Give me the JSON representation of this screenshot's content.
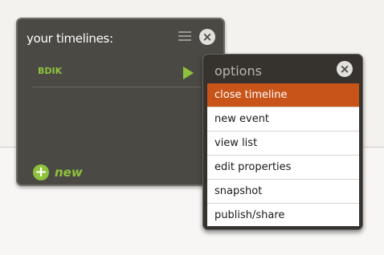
{
  "timelines_panel": {
    "title": "your timelines:",
    "items": [
      {
        "label": "BDIK"
      }
    ],
    "new_label": "new",
    "close_symbol": "×",
    "plus_symbol": "+"
  },
  "options_popup": {
    "title": "options",
    "close_symbol": "×",
    "items": [
      {
        "label": "close timeline",
        "active": true
      },
      {
        "label": "new event",
        "active": false
      },
      {
        "label": "view list",
        "active": false
      },
      {
        "label": "edit properties",
        "active": false
      },
      {
        "label": "snapshot",
        "active": false
      },
      {
        "label": "publish/share",
        "active": false
      }
    ]
  },
  "colors": {
    "accent_green": "#8fc23c",
    "active_orange": "#c9541a",
    "panel_dark": "#4b4944"
  }
}
